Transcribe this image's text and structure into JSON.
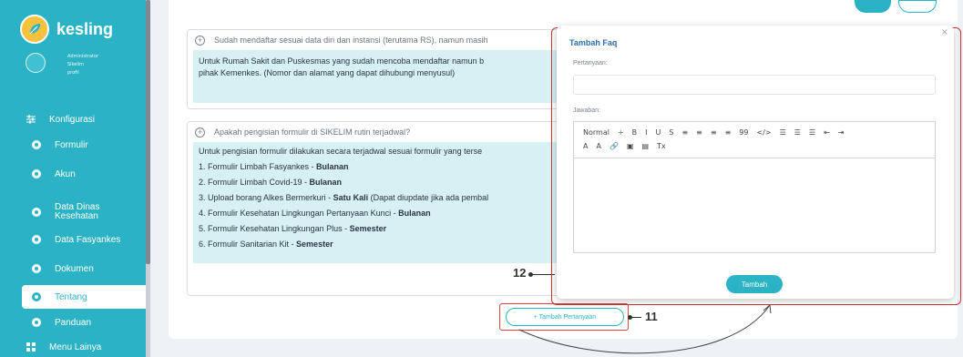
{
  "sidebar": {
    "logo_text": "kesling",
    "profile": {
      "role": "Administrator",
      "name": "Sikelim",
      "link": "profil"
    },
    "items": [
      {
        "label": "Konfigurasi",
        "icon": "sliders-icon"
      },
      {
        "label": "Formulir",
        "icon": "gear-icon"
      },
      {
        "label": "Akun",
        "icon": "gear-icon"
      },
      {
        "label": "Data Dinas\nKesehatan",
        "icon": "gear-icon"
      },
      {
        "label": "Data Fasyankes",
        "icon": "gear-icon"
      },
      {
        "label": "Dokumen",
        "icon": "gear-icon"
      },
      {
        "label": "Tentang",
        "icon": "gear-icon",
        "active": true
      },
      {
        "label": "Panduan",
        "icon": "gear-icon"
      },
      {
        "label": "Menu Lainya",
        "icon": "grid-icon"
      }
    ]
  },
  "faqs": [
    {
      "question": "Sudah mendaftar sesuai data diri dan instansi (terutama RS), namun masih",
      "answer_line1": "Untuk Rumah Sakit dan Puskesmas yang sudah mencoba mendaftar namun b",
      "answer_line2": "pihak Kemenkes. (Nomor dan alamat yang dapat dihubungi menyusul)"
    },
    {
      "question": "Apakah pengisian formulir di SIKELIM rutin terjadwal?",
      "answer_intro": "Untuk pengisian formulir dilakukan secara terjadwal sesuai formulir yang terse",
      "rows": [
        {
          "text": "1. Formulir Limbah Fasyankes - ",
          "bold": "Bulanan",
          "rest": ""
        },
        {
          "text": "2. Formulir Limbah Covid-19 - ",
          "bold": "Bulanan",
          "rest": ""
        },
        {
          "text": "3. Upload borang Alkes Bermerkuri - ",
          "bold": "Satu Kali",
          "rest": " (Dapat diupdate jika ada pembal"
        },
        {
          "text": "4. Formulir Kesehatan Lingkungan Pertanyaan Kunci - ",
          "bold": "Bulanan",
          "rest": ""
        },
        {
          "text": "5. Formulir Kesehatan Lingkungan Plus - ",
          "bold": "Semester",
          "rest": ""
        },
        {
          "text": "6. Formulir Sanitarian Kit - ",
          "bold": "Semester",
          "rest": ""
        }
      ]
    }
  ],
  "add_question_button": "+ Tambah Pertanyaan",
  "markers": {
    "m11": "11",
    "m12": "12"
  },
  "modal": {
    "close": "×",
    "title": "Tambah Faq",
    "question_label": "Pertanyaan:",
    "answer_label": "Jawaban:",
    "toolbar_row1": [
      "Normal",
      "÷",
      "B",
      "I",
      "U",
      "S",
      "≡",
      "≡",
      "≡",
      "≡",
      "99",
      "</>",
      "☰",
      "☰",
      "☰",
      "⇤",
      "⇥"
    ],
    "toolbar_row2": [
      "A",
      "A",
      "🔗",
      "▣",
      "▤",
      "Tx"
    ],
    "submit": "Tambah"
  },
  "colors": {
    "accent": "#2bb3c5",
    "title_blue": "#2a6fb1",
    "answer_bg": "#d6f0f4",
    "highlight_red": "#cc3333"
  }
}
